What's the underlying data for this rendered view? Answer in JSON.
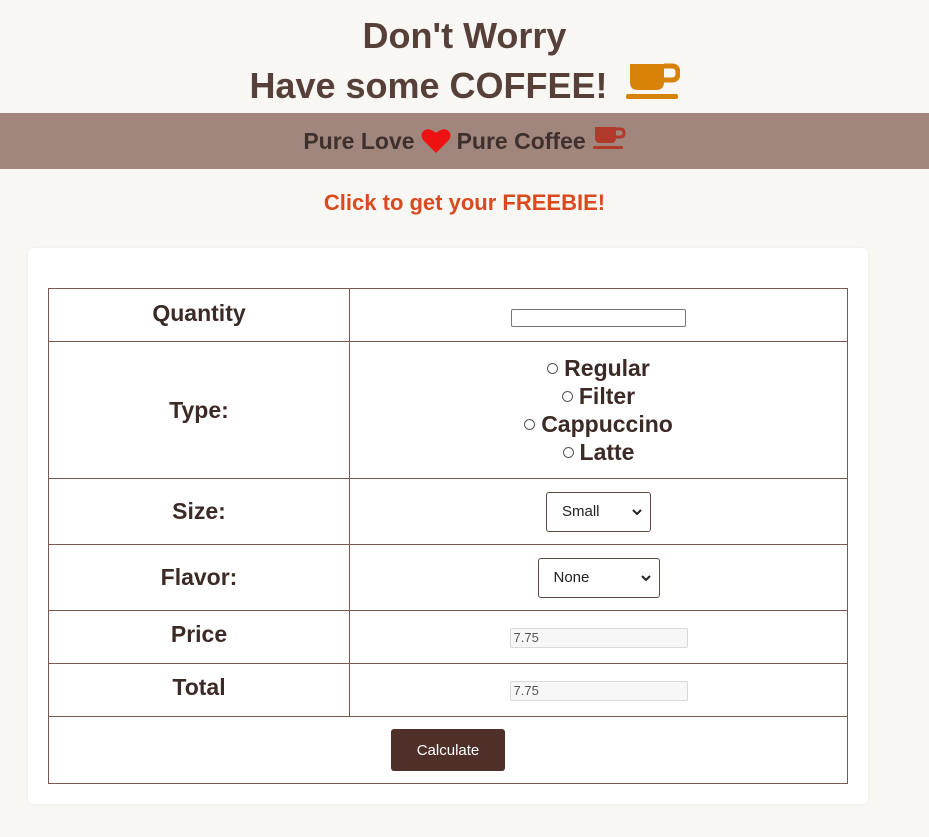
{
  "hero": {
    "line1": "Don't Worry",
    "line2": "Have some COFFEE!",
    "icon": "coffee-cup-icon",
    "icon_color": "#d9820a"
  },
  "banner": {
    "left": "Pure Love",
    "right": "Pure Coffee",
    "heart_icon": "heart-icon",
    "heart_color": "#ee1111",
    "cup_color": "#b23a2a",
    "background": "#a0867c"
  },
  "freebie": {
    "label": "Click to get your FREEBIE!",
    "color": "#d94b1e"
  },
  "form": {
    "quantity": {
      "label": "Quantity",
      "value": ""
    },
    "type": {
      "label": "Type:",
      "options": [
        "Regular",
        "Filter",
        "Cappuccino",
        "Latte"
      ]
    },
    "size": {
      "label": "Size:",
      "selected": "Small"
    },
    "flavor": {
      "label": "Flavor:",
      "selected": "None"
    },
    "price": {
      "label": "Price",
      "value": "7.75"
    },
    "total": {
      "label": "Total",
      "value": "7.75"
    },
    "calculate_label": "Calculate",
    "button_color": "#4e3029"
  }
}
